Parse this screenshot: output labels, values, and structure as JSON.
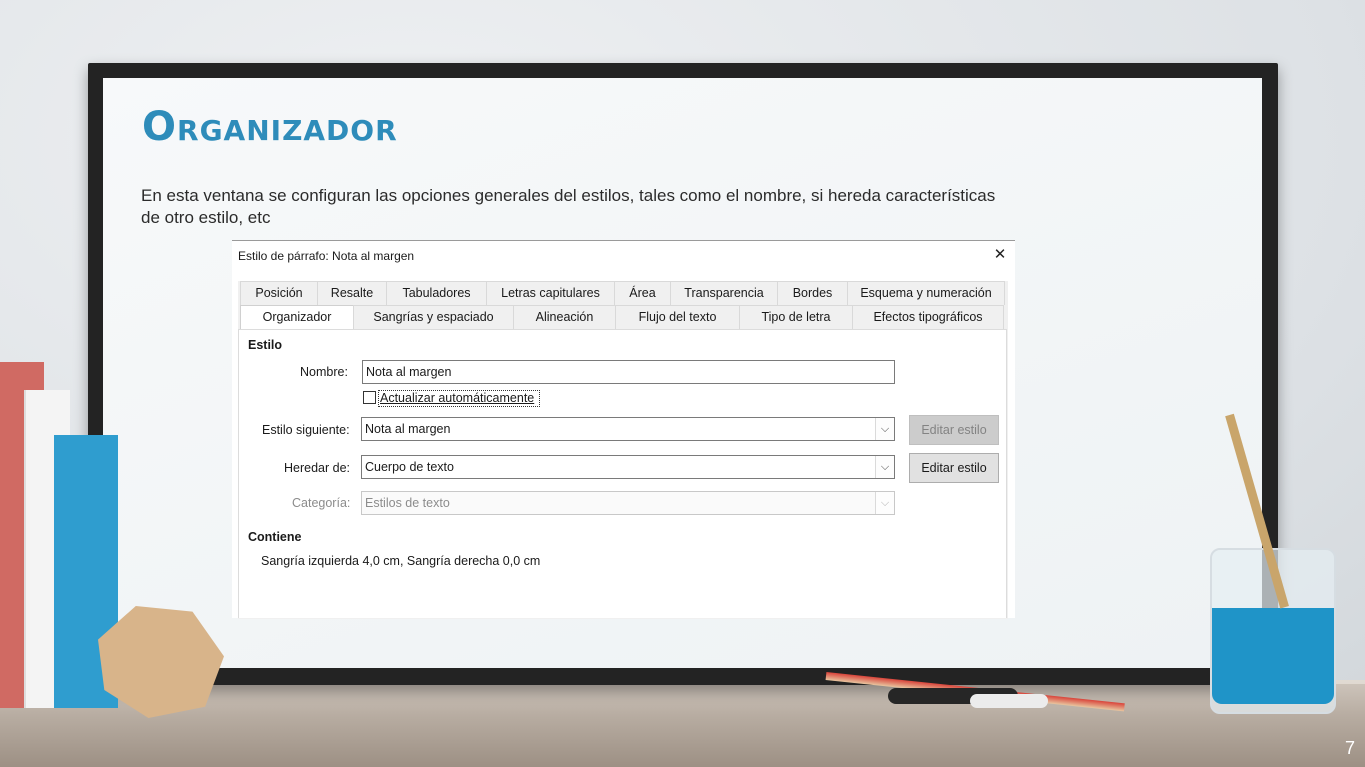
{
  "slide": {
    "title": "Organizador",
    "body": "En esta ventana se configuran las opciones generales del estilos, tales como el nombre, si hereda características de otro estilo, etc",
    "page_number": "7"
  },
  "dialog": {
    "title": "Estilo de párrafo: Nota al margen",
    "close_label": "✕",
    "tabs_row1": [
      "Posición",
      "Resalte",
      "Tabuladores",
      "Letras capitulares",
      "Área",
      "Transparencia",
      "Bordes",
      "Esquema y numeración"
    ],
    "tabs_row2": [
      "Organizador",
      "Sangrías y espaciado",
      "Alineación",
      "Flujo del texto",
      "Tipo de letra",
      "Efectos tipográficos"
    ],
    "active_tab": "Organizador",
    "style_section": {
      "heading": "Estilo",
      "name_label": "Nombre:",
      "name_value": "Nota al margen",
      "autoupdate_label": "Actualizar automáticamente",
      "autoupdate_checked": false,
      "next_style_label": "Estilo siguiente:",
      "next_style_value": "Nota al margen",
      "inherit_label": "Heredar de:",
      "inherit_value": "Cuerpo de texto",
      "category_label": "Categoría:",
      "category_value": "Estilos de texto",
      "edit_style_disabled_label": "Editar estilo",
      "edit_style_label": "Editar estilo"
    },
    "contains_section": {
      "heading": "Contiene",
      "text": "Sangría izquierda 4,0 cm, Sangría derecha 0,0 cm"
    }
  },
  "icons": {
    "combo_arrow": "chevron-down-icon",
    "close": "close-icon"
  },
  "colors": {
    "title_blue": "#2e8cba",
    "board_frame": "#232323",
    "button_gray": "#e1e1e1"
  }
}
